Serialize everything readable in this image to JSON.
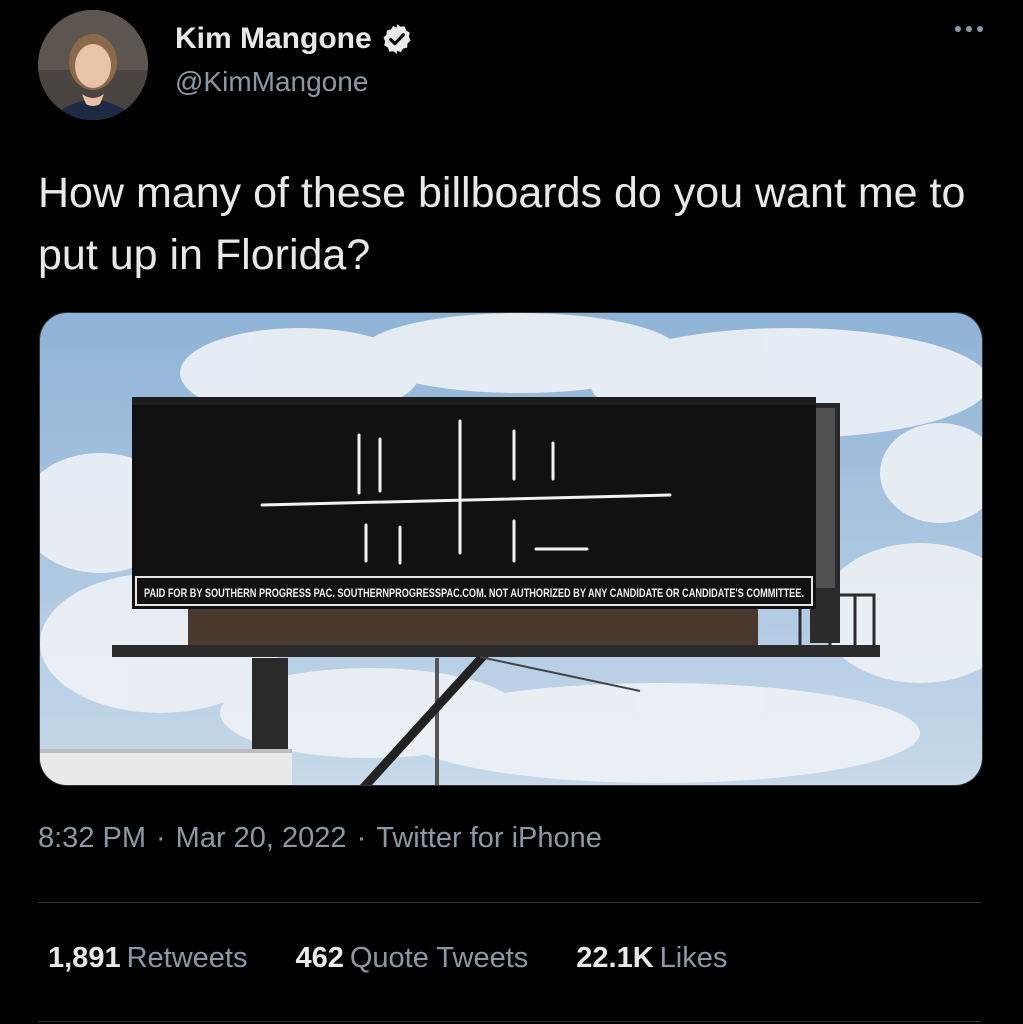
{
  "author": {
    "display_name": "Kim Mangone",
    "handle": "@KimMangone",
    "verified": true
  },
  "tweet": {
    "text": "How many of these billboards do you want me to put up in Florida?",
    "media": {
      "billboard_disclaimer": "PAID FOR BY SOUTHERN PROGRESS PAC. SOUTHERNPROGRESSPAC.COM. NOT AUTHORIZED BY ANY CANDIDATE OR CANDIDATE'S COMMITTEE."
    },
    "time": "8:32 PM",
    "date": "Mar 20, 2022",
    "source": "Twitter for iPhone"
  },
  "stats": {
    "retweets": {
      "count": "1,891",
      "label": "Retweets"
    },
    "quote_tweets": {
      "count": "462",
      "label": "Quote Tweets"
    },
    "likes": {
      "count": "22.1K",
      "label": "Likes"
    }
  },
  "colors": {
    "background": "#000000",
    "text_primary": "#e7e9ea",
    "text_secondary": "#8b98a5",
    "divider": "#2f3336",
    "verified_badge": "#e7e9ea"
  },
  "icons": {
    "verified": "verified-badge-icon",
    "more": "more-options-icon"
  }
}
